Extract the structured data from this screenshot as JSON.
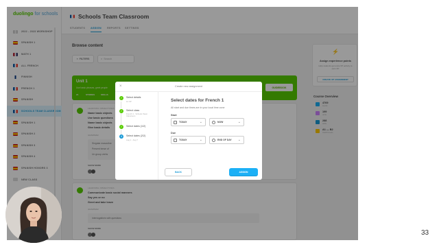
{
  "sidebar": {
    "logo_main": "duolingo",
    "logo_sub": "for schools",
    "items": [
      {
        "label": "2022 - 2023 WORKSHOP",
        "flag": "plain"
      },
      {
        "label": "SPANISH 1",
        "flag": "es"
      },
      {
        "label": "MATH 1",
        "flag": "us"
      },
      {
        "label": "ALL FRENCH",
        "flag": "fr"
      },
      {
        "label": "FINNISH",
        "flag": "fi"
      },
      {
        "label": "FRENCH 1",
        "flag": "fr"
      },
      {
        "label": "SPANISH",
        "flag": "es"
      },
      {
        "label": "SCHOOLS TEAM CLASSROOM",
        "flag": "fr"
      },
      {
        "label": "SPANISH 1",
        "flag": "es"
      },
      {
        "label": "SPANISH 2",
        "flag": "es"
      },
      {
        "label": "SPANISH 3",
        "flag": "es"
      },
      {
        "label": "SPANISH 4",
        "flag": "es"
      },
      {
        "label": "SPANISH HONORS 3",
        "flag": "es"
      },
      {
        "label": "NEW CLASS",
        "flag": "plus"
      }
    ],
    "active_index": 7
  },
  "header": {
    "title": "Schools Team Classroom",
    "tabs": [
      "STUDENTS",
      "ASSIGN",
      "REPORTS",
      "SETTINGS"
    ],
    "active_tab": 1
  },
  "main": {
    "browse_title": "Browse content",
    "filters_label": "FILTERS",
    "search_placeholder": "Search",
    "unit": {
      "title": "Unit 1",
      "description": "Use basic phrases, greet people",
      "chips": [
        "21",
        "STORIES",
        "SKILLS"
      ],
      "button": "GUIDEBOOK"
    },
    "lesson1": {
      "kicker": "LEARNING OBJECTIVES",
      "lines": [
        "Name basic objects",
        "Use basic questions",
        "Name basic objects",
        "Give basic details"
      ],
      "sub": "GRAMMAR",
      "box_lines": [
        "Singular masculine",
        "Present tense of",
        "Un group verbs"
      ],
      "show_more": "SHOW MORE"
    },
    "lesson2": {
      "kicker": "LEARNING OBJECTIVES",
      "lines": [
        "Communicate basic social manners",
        "Say yes or no",
        "Greet and take leave"
      ],
      "sub": "GRAMMAR",
      "box_lines": [
        "Interrogatives with questions"
      ],
      "show_more": "SHOW MORE"
    }
  },
  "right_panel": {
    "assign_title": "Assign experience points",
    "assign_desc": "Help students get extra XP activity to earn XP",
    "assign_button": "CREATE XP ASSIGNMENT",
    "overview_title": "Course Overview",
    "stats": [
      {
        "value": "4769",
        "label": "words",
        "color": "#1cb0f6"
      },
      {
        "value": "199",
        "label": "units",
        "color": "#ce82ff"
      },
      {
        "value": "288",
        "label": "skills",
        "color": "#1899d6"
      },
      {
        "value": "A1 — B2",
        "label": "CEFR levels",
        "color": "#ffc800"
      }
    ]
  },
  "modal": {
    "title": "Create new assignment",
    "steps": [
      {
        "title": "Select details",
        "detail": "12 XP",
        "state": "done"
      },
      {
        "title": "Select class",
        "detail": "French 1 · Schools Team Classroom",
        "state": "done"
      },
      {
        "title": "Select dates (1/2)",
        "detail": "",
        "state": "done"
      },
      {
        "title": "Select dates (2/2)",
        "detail": "Aug 1 · Aug 7",
        "state": "current",
        "number": "4"
      }
    ],
    "body_title": "Select dates for French 1",
    "body_desc": "All start and due times are in your local time zone",
    "start_label": "Start",
    "start_date": "TODAY",
    "start_time": "NOW",
    "due_label": "Due",
    "due_date": "TODAY",
    "due_time": "END OF DAY",
    "back_label": "BACK",
    "assign_label": "ASSIGN"
  },
  "slide_number": "33",
  "colors": {
    "brand_green": "#58cc02",
    "brand_blue": "#1cb0f6",
    "active_blue": "#1899d6"
  }
}
